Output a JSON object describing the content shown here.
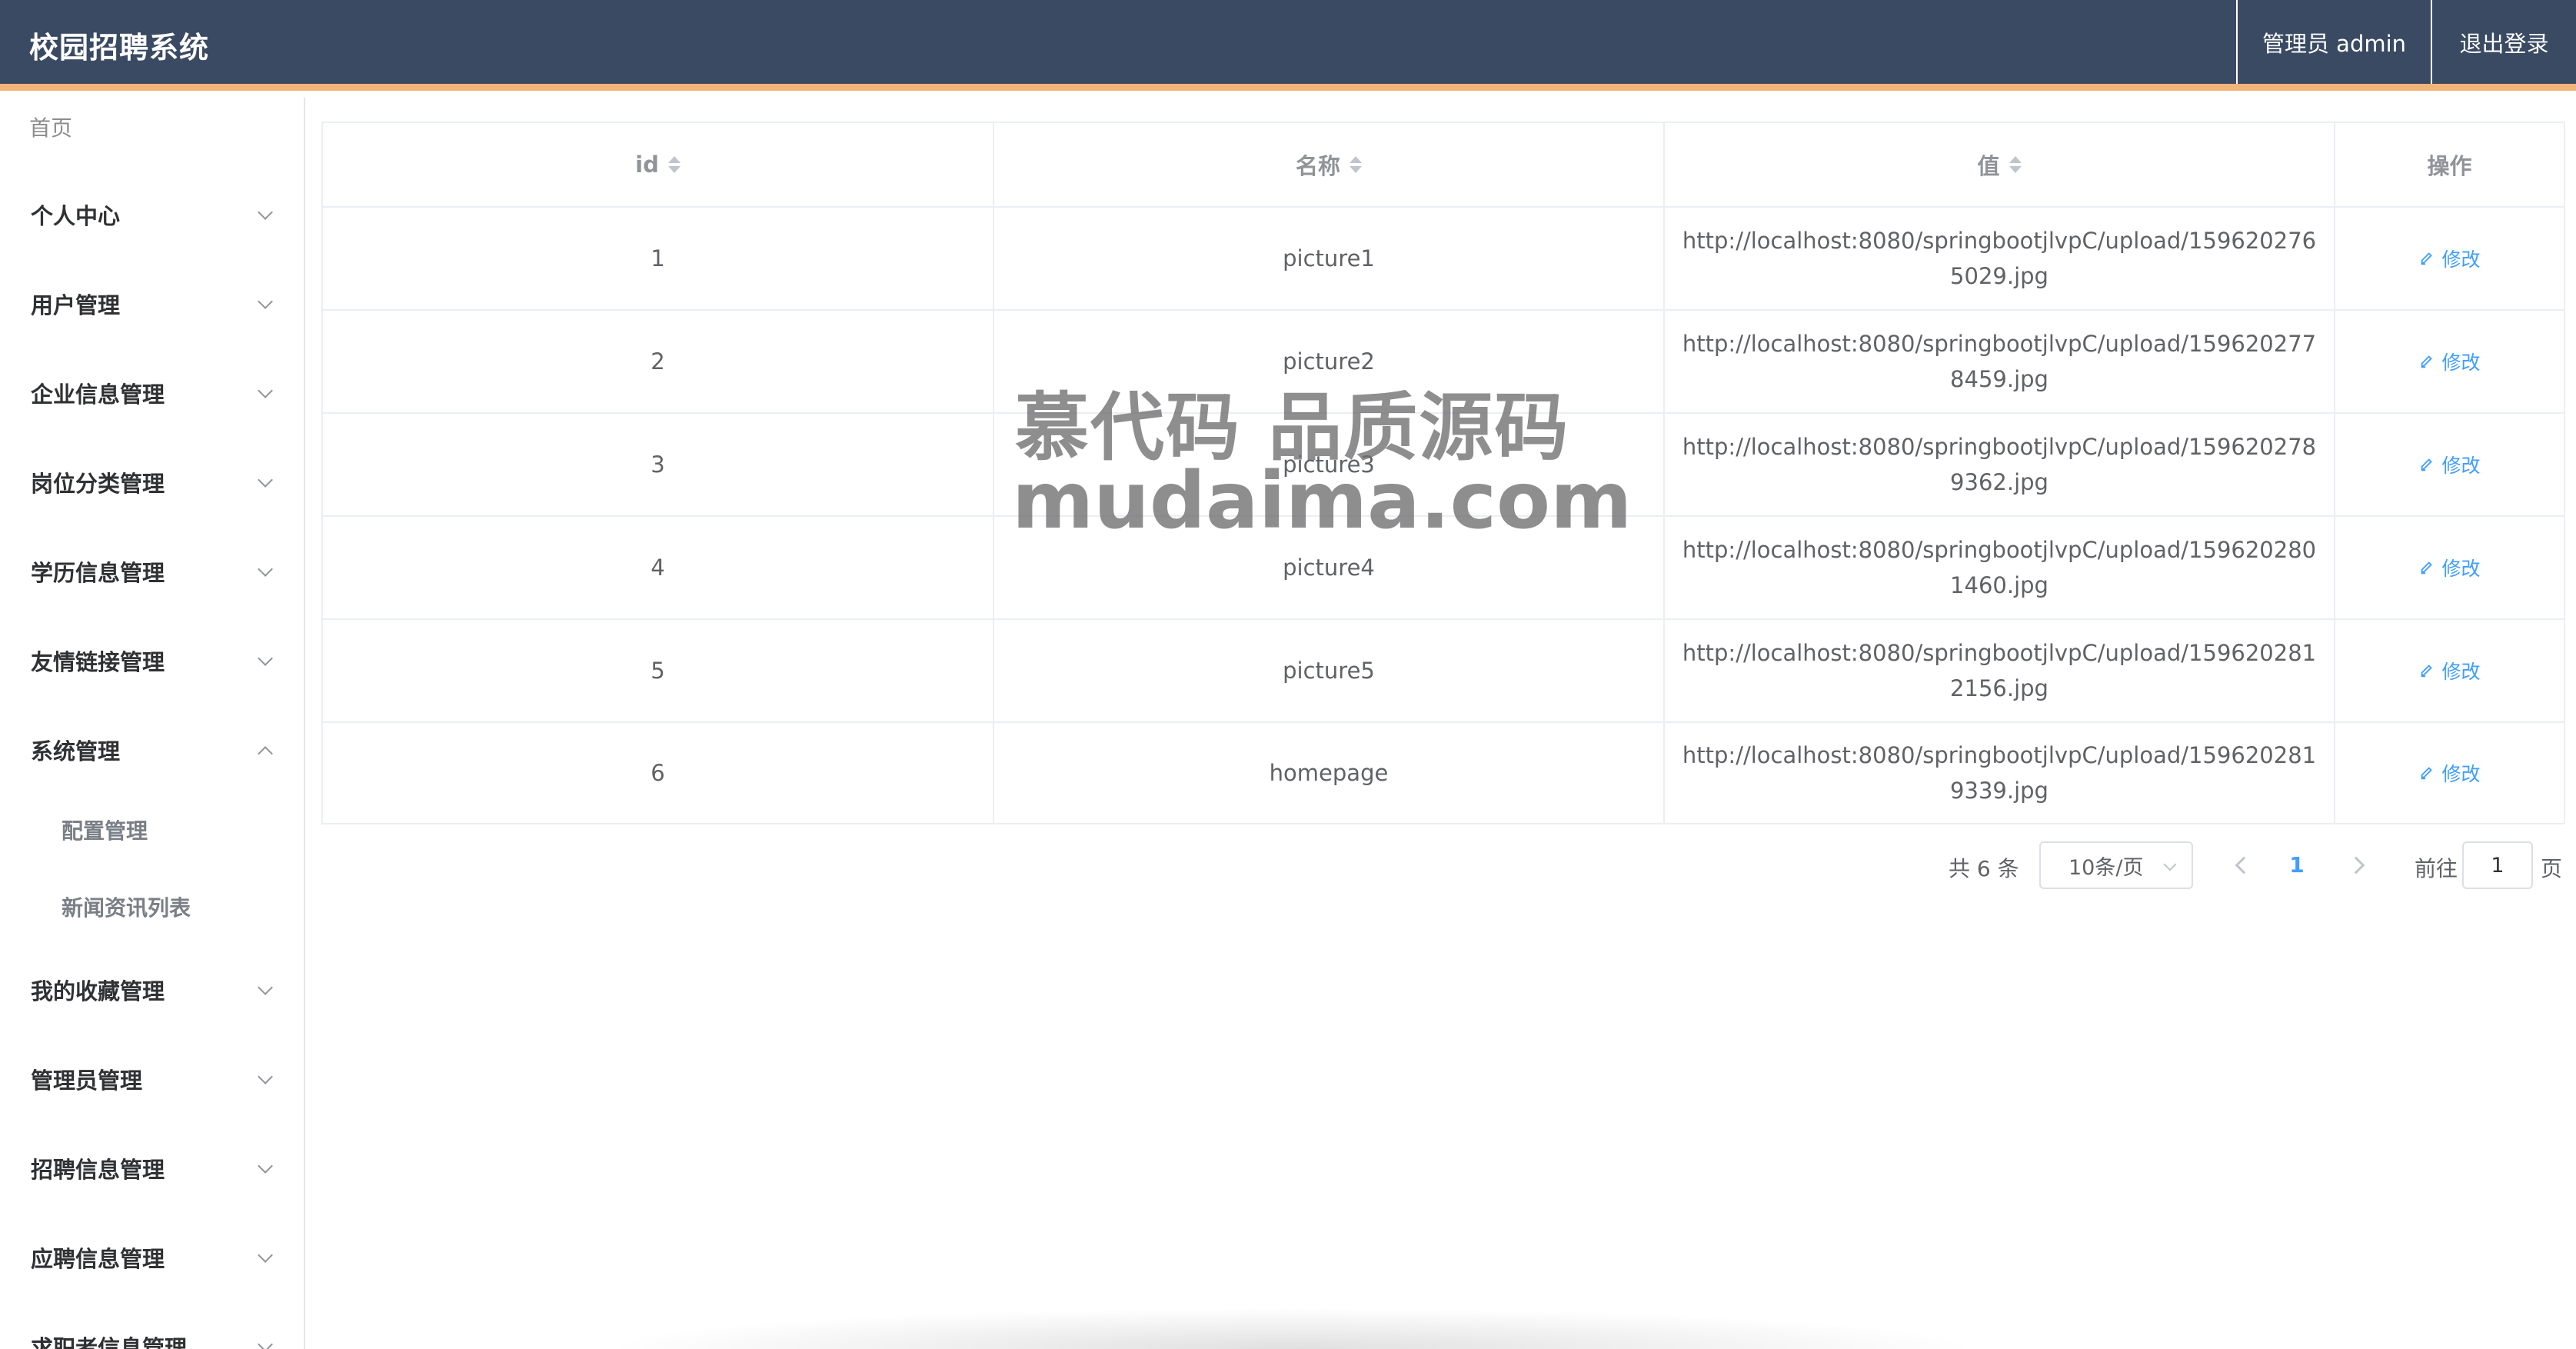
{
  "header": {
    "title": "校园招聘系统",
    "admin_label": "管理员 admin",
    "logout_label": "退出登录",
    "accent_color": "#f3b47a",
    "bg_color": "#3a4a63"
  },
  "sidebar": {
    "home_label": "首页",
    "items": [
      {
        "label": "个人中心",
        "expanded": false
      },
      {
        "label": "用户管理",
        "expanded": false
      },
      {
        "label": "企业信息管理",
        "expanded": false
      },
      {
        "label": "岗位分类管理",
        "expanded": false
      },
      {
        "label": "学历信息管理",
        "expanded": false
      },
      {
        "label": "友情链接管理",
        "expanded": false
      },
      {
        "label": "系统管理",
        "expanded": true,
        "children": [
          {
            "label": "配置管理"
          },
          {
            "label": "新闻资讯列表"
          }
        ]
      },
      {
        "label": "我的收藏管理",
        "expanded": false
      },
      {
        "label": "管理员管理",
        "expanded": false
      },
      {
        "label": "招聘信息管理",
        "expanded": false
      },
      {
        "label": "应聘信息管理",
        "expanded": false
      },
      {
        "label": "求职者信息管理",
        "expanded": false
      }
    ]
  },
  "table": {
    "columns": [
      "id",
      "名称",
      "值",
      "操作"
    ],
    "rows": [
      {
        "id": "1",
        "name": "picture1",
        "value": "http://localhost:8080/springbootjlvpC/upload/1596202765029.jpg",
        "action": "修改"
      },
      {
        "id": "2",
        "name": "picture2",
        "value": "http://localhost:8080/springbootjlvpC/upload/1596202778459.jpg",
        "action": "修改"
      },
      {
        "id": "3",
        "name": "picture3",
        "value": "http://localhost:8080/springbootjlvpC/upload/1596202789362.jpg",
        "action": "修改"
      },
      {
        "id": "4",
        "name": "picture4",
        "value": "http://localhost:8080/springbootjlvpC/upload/1596202801460.jpg",
        "action": "修改"
      },
      {
        "id": "5",
        "name": "picture5",
        "value": "http://localhost:8080/springbootjlvpC/upload/1596202812156.jpg",
        "action": "修改"
      },
      {
        "id": "6",
        "name": "homepage",
        "value": "http://localhost:8080/springbootjlvpC/upload/1596202819339.jpg",
        "action": "修改"
      }
    ]
  },
  "pagination": {
    "total_text": "共 6 条",
    "page_size": "10条/页",
    "current_page": "1",
    "goto_label": "前往",
    "goto_value": "1",
    "page_suffix": "页"
  },
  "watermark": {
    "line1": "慕代码 品质源码",
    "line2": "mudaima.com"
  }
}
